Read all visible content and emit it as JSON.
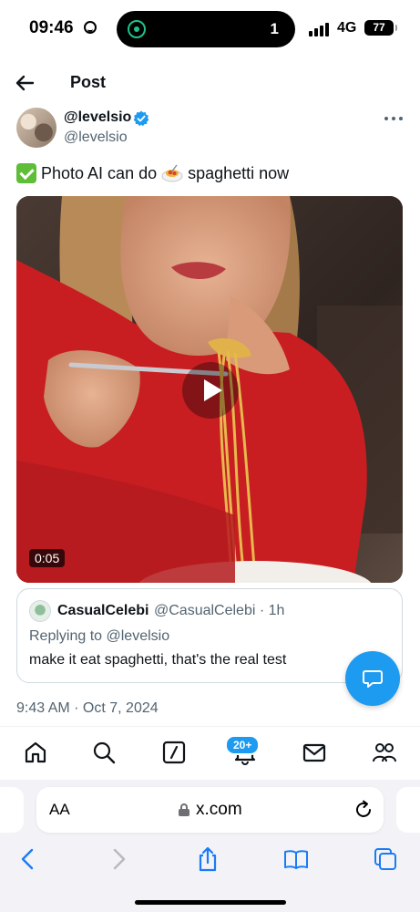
{
  "status_bar": {
    "time": "09:46",
    "island_count": "1",
    "network": "4G",
    "battery": "77"
  },
  "header": {
    "title": "Post"
  },
  "tweet": {
    "display_name": "@levelsio",
    "handle": "@levelsio",
    "text": "Photo AI can do",
    "text_after": "spaghetti now",
    "video_duration": "0:05",
    "timestamp": "9:43 AM · Oct 7, 2024"
  },
  "quote": {
    "name": "CasualCelebi",
    "meta": "@CasualCelebi · 1h",
    "replying_to": "Replying to @levelsio",
    "text": "make it eat spaghetti, that's the real test"
  },
  "tabbar": {
    "notifications_badge": "20+",
    "items": [
      "home-icon",
      "search-icon",
      "grok-icon",
      "notifications-icon",
      "messages-icon",
      "communities-icon"
    ]
  },
  "browser": {
    "aa_label": "AA",
    "url": "x.com"
  },
  "colors": {
    "accent": "#1d9bf0",
    "secondary_text": "#536471"
  }
}
